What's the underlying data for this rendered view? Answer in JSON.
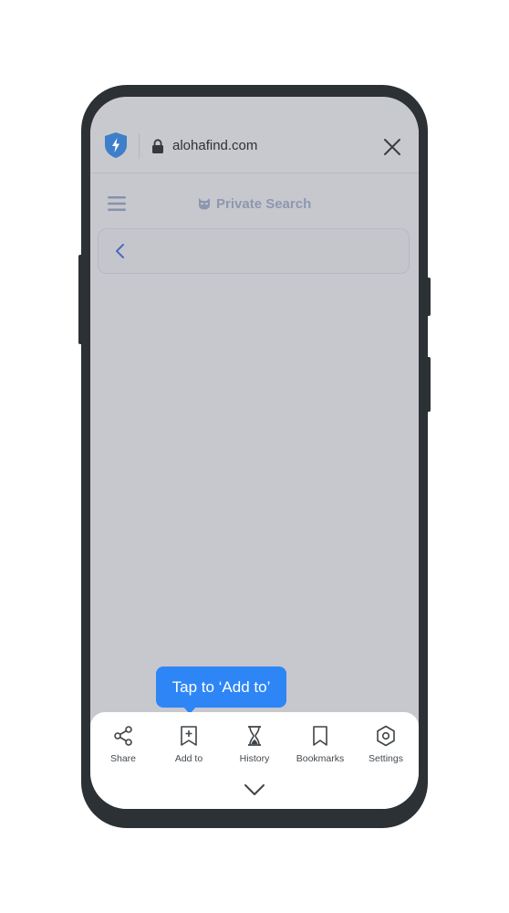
{
  "browser": {
    "url": "alohafind.com",
    "icons": {
      "shield": "lightning-shield-icon",
      "lock": "lock-icon",
      "close": "close-icon"
    }
  },
  "page": {
    "brand": "Private Search",
    "brand_icon": "cat-mask-icon",
    "menu_icon": "hamburger-menu-icon",
    "back_icon": "chevron-left-icon"
  },
  "tooltip": {
    "text": "Tap to ‘Add to’"
  },
  "bottom_bar": {
    "items": [
      {
        "label": "Share",
        "icon": "share-icon"
      },
      {
        "label": "Add to",
        "icon": "bookmark-add-icon"
      },
      {
        "label": "History",
        "icon": "hourglass-icon"
      },
      {
        "label": "Bookmarks",
        "icon": "bookmark-icon"
      },
      {
        "label": "Settings",
        "icon": "hexagon-settings-icon"
      }
    ],
    "collapse_icon": "chevron-down-icon"
  },
  "colors": {
    "accent": "#2e86f6",
    "shield": "#3d7fc9",
    "overlay": "#c7c8cd",
    "device": "#2b3134"
  }
}
